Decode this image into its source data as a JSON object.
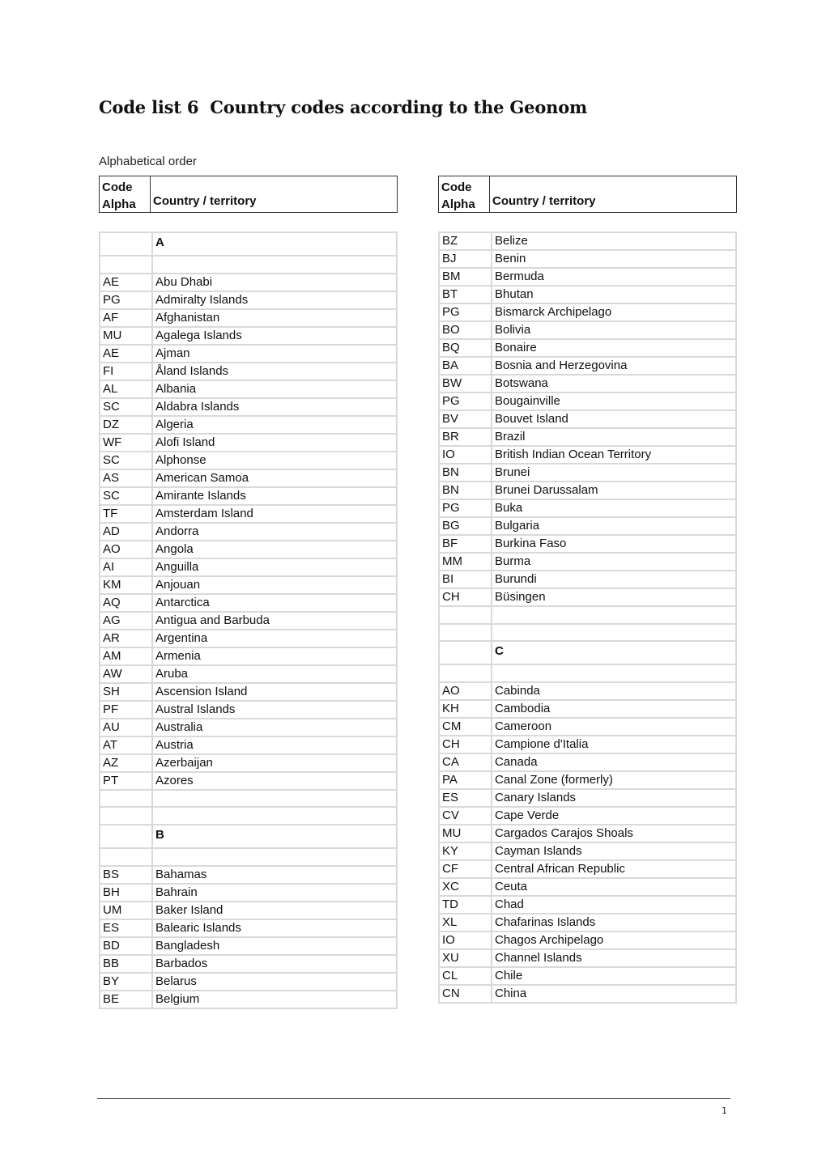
{
  "title": {
    "number": "Code list 6",
    "text": "Country codes according to the Geonom"
  },
  "subtitle": "Alphabetical order",
  "table_header": {
    "code_line1": "Code",
    "code_line2": "Alpha",
    "country": "Country / territory"
  },
  "left_rows": [
    {
      "type": "letter",
      "code": "",
      "name": "A"
    },
    {
      "type": "blank",
      "code": "",
      "name": ""
    },
    {
      "type": "row",
      "code": "AE",
      "name": "Abu Dhabi"
    },
    {
      "type": "row",
      "code": "PG",
      "name": "Admiralty Islands"
    },
    {
      "type": "row",
      "code": "AF",
      "name": "Afghanistan"
    },
    {
      "type": "row",
      "code": "MU",
      "name": "Agalega Islands"
    },
    {
      "type": "row",
      "code": "AE",
      "name": "Ajman"
    },
    {
      "type": "row",
      "code": "FI",
      "name": "Åland Islands"
    },
    {
      "type": "row",
      "code": "AL",
      "name": "Albania"
    },
    {
      "type": "row",
      "code": "SC",
      "name": "Aldabra Islands"
    },
    {
      "type": "row",
      "code": "DZ",
      "name": "Algeria"
    },
    {
      "type": "row",
      "code": "WF",
      "name": "Alofi Island"
    },
    {
      "type": "row",
      "code": "SC",
      "name": "Alphonse"
    },
    {
      "type": "row",
      "code": "AS",
      "name": "American Samoa"
    },
    {
      "type": "row",
      "code": "SC",
      "name": "Amirante Islands"
    },
    {
      "type": "row",
      "code": "TF",
      "name": "Amsterdam Island"
    },
    {
      "type": "row",
      "code": "AD",
      "name": "Andorra"
    },
    {
      "type": "row",
      "code": "AO",
      "name": "Angola"
    },
    {
      "type": "row",
      "code": "AI",
      "name": "Anguilla"
    },
    {
      "type": "row",
      "code": "KM",
      "name": "Anjouan"
    },
    {
      "type": "row",
      "code": "AQ",
      "name": "Antarctica"
    },
    {
      "type": "row",
      "code": "AG",
      "name": "Antigua and Barbuda"
    },
    {
      "type": "row",
      "code": "AR",
      "name": "Argentina"
    },
    {
      "type": "row",
      "code": "AM",
      "name": "Armenia"
    },
    {
      "type": "row",
      "code": "AW",
      "name": "Aruba"
    },
    {
      "type": "row",
      "code": "SH",
      "name": "Ascension Island"
    },
    {
      "type": "row",
      "code": "PF",
      "name": "Austral Islands"
    },
    {
      "type": "row",
      "code": "AU",
      "name": "Australia"
    },
    {
      "type": "row",
      "code": "AT",
      "name": "Austria"
    },
    {
      "type": "row",
      "code": "AZ",
      "name": "Azerbaijan"
    },
    {
      "type": "row",
      "code": "PT",
      "name": "Azores"
    },
    {
      "type": "blank",
      "code": "",
      "name": ""
    },
    {
      "type": "blank",
      "code": "",
      "name": ""
    },
    {
      "type": "letter",
      "code": "",
      "name": "B"
    },
    {
      "type": "blank",
      "code": "",
      "name": ""
    },
    {
      "type": "row",
      "code": "BS",
      "name": "Bahamas"
    },
    {
      "type": "row",
      "code": "BH",
      "name": "Bahrain"
    },
    {
      "type": "row",
      "code": "UM",
      "name": "Baker Island"
    },
    {
      "type": "row",
      "code": "ES",
      "name": "Balearic Islands"
    },
    {
      "type": "row",
      "code": "BD",
      "name": "Bangladesh"
    },
    {
      "type": "row",
      "code": "BB",
      "name": "Barbados"
    },
    {
      "type": "row",
      "code": "BY",
      "name": "Belarus"
    },
    {
      "type": "row",
      "code": "BE",
      "name": "Belgium"
    }
  ],
  "right_rows": [
    {
      "type": "row",
      "code": "BZ",
      "name": "Belize"
    },
    {
      "type": "row",
      "code": "BJ",
      "name": "Benin"
    },
    {
      "type": "row",
      "code": "BM",
      "name": "Bermuda"
    },
    {
      "type": "row",
      "code": "BT",
      "name": "Bhutan"
    },
    {
      "type": "row",
      "code": "PG",
      "name": "Bismarck Archipelago"
    },
    {
      "type": "row",
      "code": "BO",
      "name": "Bolivia"
    },
    {
      "type": "row",
      "code": "BQ",
      "name": "Bonaire"
    },
    {
      "type": "row",
      "code": "BA",
      "name": "Bosnia and Herzegovina"
    },
    {
      "type": "row",
      "code": "BW",
      "name": "Botswana"
    },
    {
      "type": "row",
      "code": "PG",
      "name": "Bougainville"
    },
    {
      "type": "row",
      "code": "BV",
      "name": "Bouvet Island"
    },
    {
      "type": "row",
      "code": "BR",
      "name": "Brazil"
    },
    {
      "type": "row",
      "code": "IO",
      "name": "British Indian Ocean Territory"
    },
    {
      "type": "row",
      "code": "BN",
      "name": "Brunei"
    },
    {
      "type": "row",
      "code": "BN",
      "name": "Brunei Darussalam"
    },
    {
      "type": "row",
      "code": "PG",
      "name": "Buka"
    },
    {
      "type": "row",
      "code": "BG",
      "name": "Bulgaria"
    },
    {
      "type": "row",
      "code": "BF",
      "name": "Burkina Faso"
    },
    {
      "type": "row",
      "code": "MM",
      "name": "Burma"
    },
    {
      "type": "row",
      "code": "BI",
      "name": "Burundi"
    },
    {
      "type": "row",
      "code": "CH",
      "name": "Büsingen"
    },
    {
      "type": "blank",
      "code": "",
      "name": ""
    },
    {
      "type": "blank",
      "code": "",
      "name": ""
    },
    {
      "type": "letter",
      "code": "",
      "name": "C"
    },
    {
      "type": "blank",
      "code": "",
      "name": ""
    },
    {
      "type": "row",
      "code": "AO",
      "name": "Cabinda"
    },
    {
      "type": "row",
      "code": "KH",
      "name": "Cambodia"
    },
    {
      "type": "row",
      "code": "CM",
      "name": "Cameroon"
    },
    {
      "type": "row",
      "code": "CH",
      "name": "Campione d'Italia"
    },
    {
      "type": "row",
      "code": "CA",
      "name": "Canada"
    },
    {
      "type": "row",
      "code": "PA",
      "name": "Canal Zone (formerly)"
    },
    {
      "type": "row",
      "code": "ES",
      "name": "Canary Islands"
    },
    {
      "type": "row",
      "code": "CV",
      "name": "Cape Verde"
    },
    {
      "type": "row",
      "code": "MU",
      "name": "Cargados Carajos Shoals"
    },
    {
      "type": "row",
      "code": "KY",
      "name": "Cayman Islands"
    },
    {
      "type": "row",
      "code": "CF",
      "name": "Central African Republic"
    },
    {
      "type": "row",
      "code": "XC",
      "name": "Ceuta"
    },
    {
      "type": "row",
      "code": "TD",
      "name": "Chad"
    },
    {
      "type": "row",
      "code": "XL",
      "name": "Chafarinas Islands"
    },
    {
      "type": "row",
      "code": "IO",
      "name": "Chagos Archipelago"
    },
    {
      "type": "row",
      "code": "XU",
      "name": "Channel Islands"
    },
    {
      "type": "row",
      "code": "CL",
      "name": "Chile"
    },
    {
      "type": "row",
      "code": "CN",
      "name": "China"
    }
  ],
  "footer": {
    "page_number": "1"
  }
}
